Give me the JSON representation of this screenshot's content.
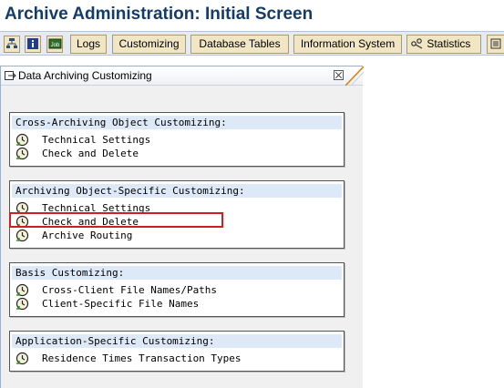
{
  "window": {
    "title": "Archive Administration: Initial Screen"
  },
  "toolbar": {
    "icons": [
      {
        "name": "hierarchy-icon"
      },
      {
        "name": "info-icon"
      },
      {
        "name": "job-icon"
      }
    ],
    "buttons": [
      {
        "label": "Logs"
      },
      {
        "label": "Customizing"
      },
      {
        "label": "Database Tables"
      },
      {
        "label": "Information System"
      },
      {
        "label": "Statistics",
        "icon": "statistics-icon"
      }
    ]
  },
  "panel": {
    "title": "Data Archiving Customizing",
    "groups": [
      {
        "title": "Cross-Archiving Object Customizing:",
        "items": [
          {
            "label": "Technical Settings",
            "icon": "execute-clock-icon"
          },
          {
            "label": "Check and Delete",
            "icon": "execute-clock-icon"
          }
        ]
      },
      {
        "title": "Archiving Object-Specific Customizing:",
        "items": [
          {
            "label": "Technical Settings",
            "icon": "execute-clock-icon"
          },
          {
            "label": "Check and Delete",
            "icon": "execute-clock-icon",
            "highlighted": true
          },
          {
            "label": "Archive Routing",
            "icon": "execute-clock-icon"
          }
        ]
      },
      {
        "title": "Basis Customizing:",
        "items": [
          {
            "label": "Cross-Client File Names/Paths",
            "icon": "execute-clock-icon"
          },
          {
            "label": "Client-Specific File Names",
            "icon": "execute-clock-icon"
          }
        ]
      },
      {
        "title": "Application-Specific Customizing:",
        "items": [
          {
            "label": "Residence Times Transaction Types",
            "icon": "execute-clock-icon"
          }
        ]
      }
    ]
  },
  "colors": {
    "title": "#153c66",
    "button_bg": "#f1e6c4",
    "group_title_bg": "#dde9f6",
    "highlight": "#cc1f1f"
  }
}
